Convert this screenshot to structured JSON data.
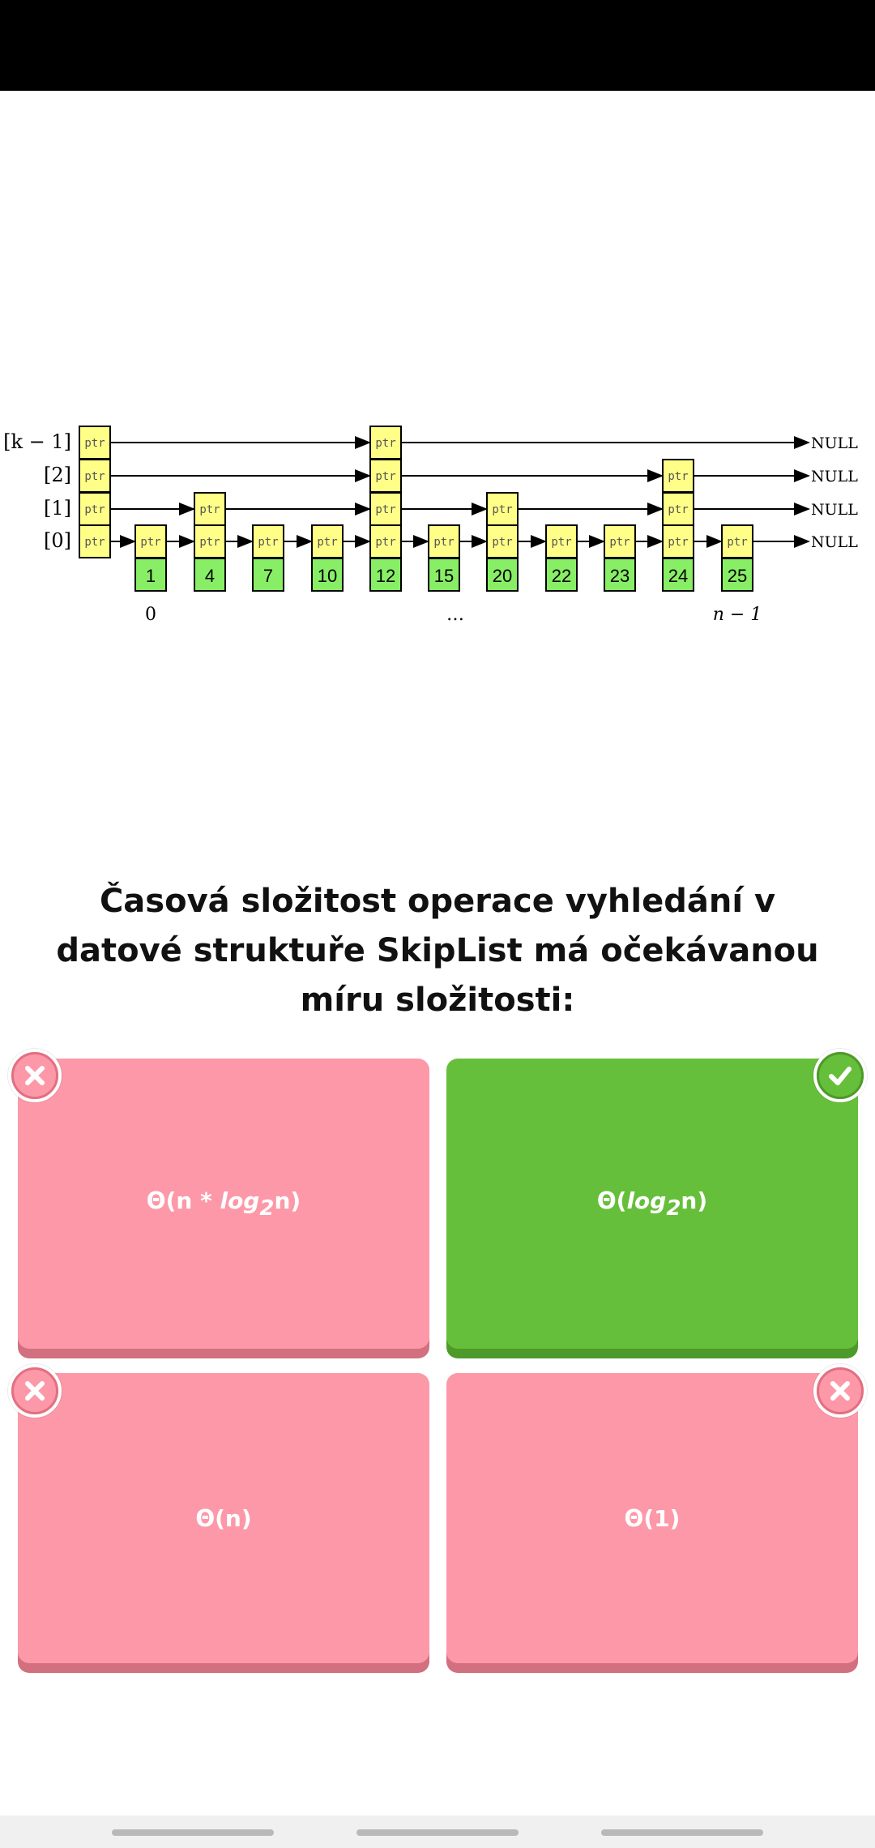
{
  "diagram": {
    "level_labels": [
      "[k − 1]",
      "[2]",
      "[1]",
      "[0]"
    ],
    "pointer_label": "ptr",
    "null_label": "NULL",
    "keys": [
      "1",
      "4",
      "7",
      "10",
      "12",
      "15",
      "20",
      "22",
      "23",
      "24",
      "25"
    ],
    "index_labels": [
      "0",
      "…",
      "n − 1"
    ]
  },
  "question": {
    "text": "Časová složitost operace vyhledání v datové struktuře SkipList má očekávanou míru složitosti:"
  },
  "answers": [
    {
      "prefix": "Θ(n * ",
      "log": "log",
      "sub": "2",
      "suffix": "n)",
      "state": "wrong"
    },
    {
      "prefix": "Θ(",
      "log": "log",
      "sub": "2",
      "suffix": "n)",
      "state": "correct"
    },
    {
      "label": "Θ(n)",
      "state": "wrong"
    },
    {
      "label": "Θ(1)",
      "state": "wrong"
    }
  ],
  "colors": {
    "wrong": "#fd98a8",
    "correct": "#66bf3a",
    "ptr_cell": "#ffff88",
    "key_cell": "#88ee66"
  }
}
